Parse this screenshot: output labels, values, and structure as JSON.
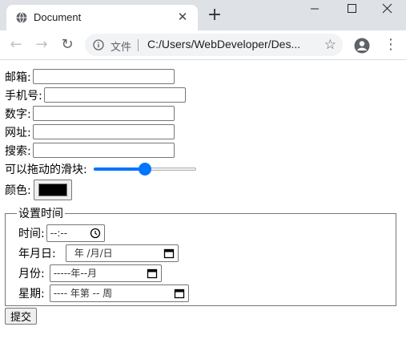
{
  "browser": {
    "tab_title": "Document",
    "new_tab_symbol": "+",
    "omnibox": {
      "file_label": "文件",
      "url": "C:/Users/WebDeveloper/Des..."
    }
  },
  "form": {
    "email_label": "邮箱:",
    "email_value": "",
    "phone_label": "手机号:",
    "phone_value": "",
    "number_label": "数字:",
    "number_value": "",
    "url_label": "网址:",
    "url_value": "",
    "search_label": "搜索:",
    "search_value": "",
    "slider_label": "可以拖动的滑块:",
    "slider_fraction": 0.5,
    "color_label": "颜色:",
    "color_value": "#000000",
    "fieldset_legend": "设置时间",
    "time_label": "时间:",
    "time_text": "--:--",
    "date_label": "年月日:",
    "date_text": "年 /月/日",
    "month_label": "月份:",
    "month_text": "-----年--月",
    "week_label": "星期:",
    "week_text": "---- 年第 -- 周",
    "submit_label": "提交"
  },
  "colors": {
    "accent": "#0075ff",
    "tabstrip": "#dee1e6",
    "omnibox": "#f1f3f4"
  }
}
